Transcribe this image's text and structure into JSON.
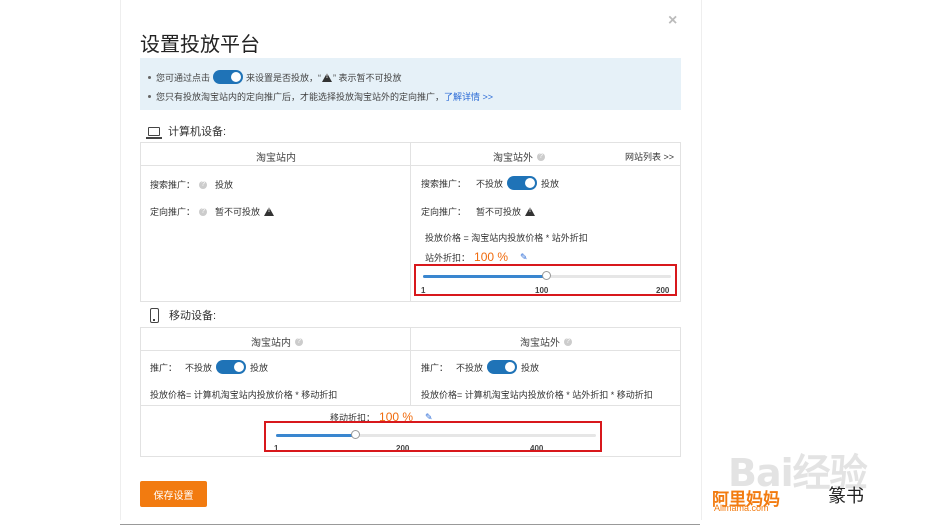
{
  "dialog": {
    "title": "设置投放平台",
    "close_label": "×"
  },
  "notice": {
    "line1_a": "您可通过点击",
    "line1_b": "来设置是否投放，“",
    "line1_c": "” 表示暂不可投放",
    "line2_text": "您只有投放淘宝站内的定向推广后，才能选择投放淘宝站外的定向推广，",
    "line2_link": "了解详情 >>"
  },
  "pc": {
    "heading": "计算机设备:",
    "inner_col": "淘宝站内",
    "outer_col": "淘宝站外",
    "site_list_link": "网站列表 >>",
    "search_label": "搜索推广：",
    "search_inner_value": "投放",
    "target_label": "定向推广：",
    "target_inner_value": "暂不可投放",
    "search_outer_off": "不投放",
    "search_outer_on": "投放",
    "target_outer_value": "暂不可投放",
    "price_formula": "投放价格 = 淘宝站内投放价格 * 站外折扣",
    "discount_label": "站外折扣：",
    "discount_value": "100 %",
    "slider": {
      "min": "1",
      "mid": "100",
      "max": "200",
      "value": 100,
      "range": [
        1,
        200
      ]
    }
  },
  "mobile": {
    "heading": "移动设备:",
    "inner_col": "淘宝站内",
    "outer_col": "淘宝站外",
    "promo_label": "推广：",
    "promo_off": "不投放",
    "promo_on": "投放",
    "inner_price": "投放价格= 计算机淘宝站内投放价格 * 移动折扣",
    "outer_price": "投放价格= 计算机淘宝站内投放价格 * 站外折扣 * 移动折扣",
    "discount_label": "移动折扣：",
    "discount_value": "100 %",
    "slider": {
      "min": "1",
      "mid": "200",
      "max": "400",
      "value": 100,
      "range": [
        1,
        400
      ]
    }
  },
  "footer": {
    "save_label": "保存设置"
  },
  "watermark": {
    "baidu": "Bai经验",
    "alimama": "阿里妈妈",
    "alimama_en": "Alimama.com",
    "signature": "篆书"
  },
  "colors": {
    "accent": "#f27b10",
    "toggle": "#1f73b7",
    "highlight": "#d8181c",
    "link": "#2a6ad6"
  }
}
